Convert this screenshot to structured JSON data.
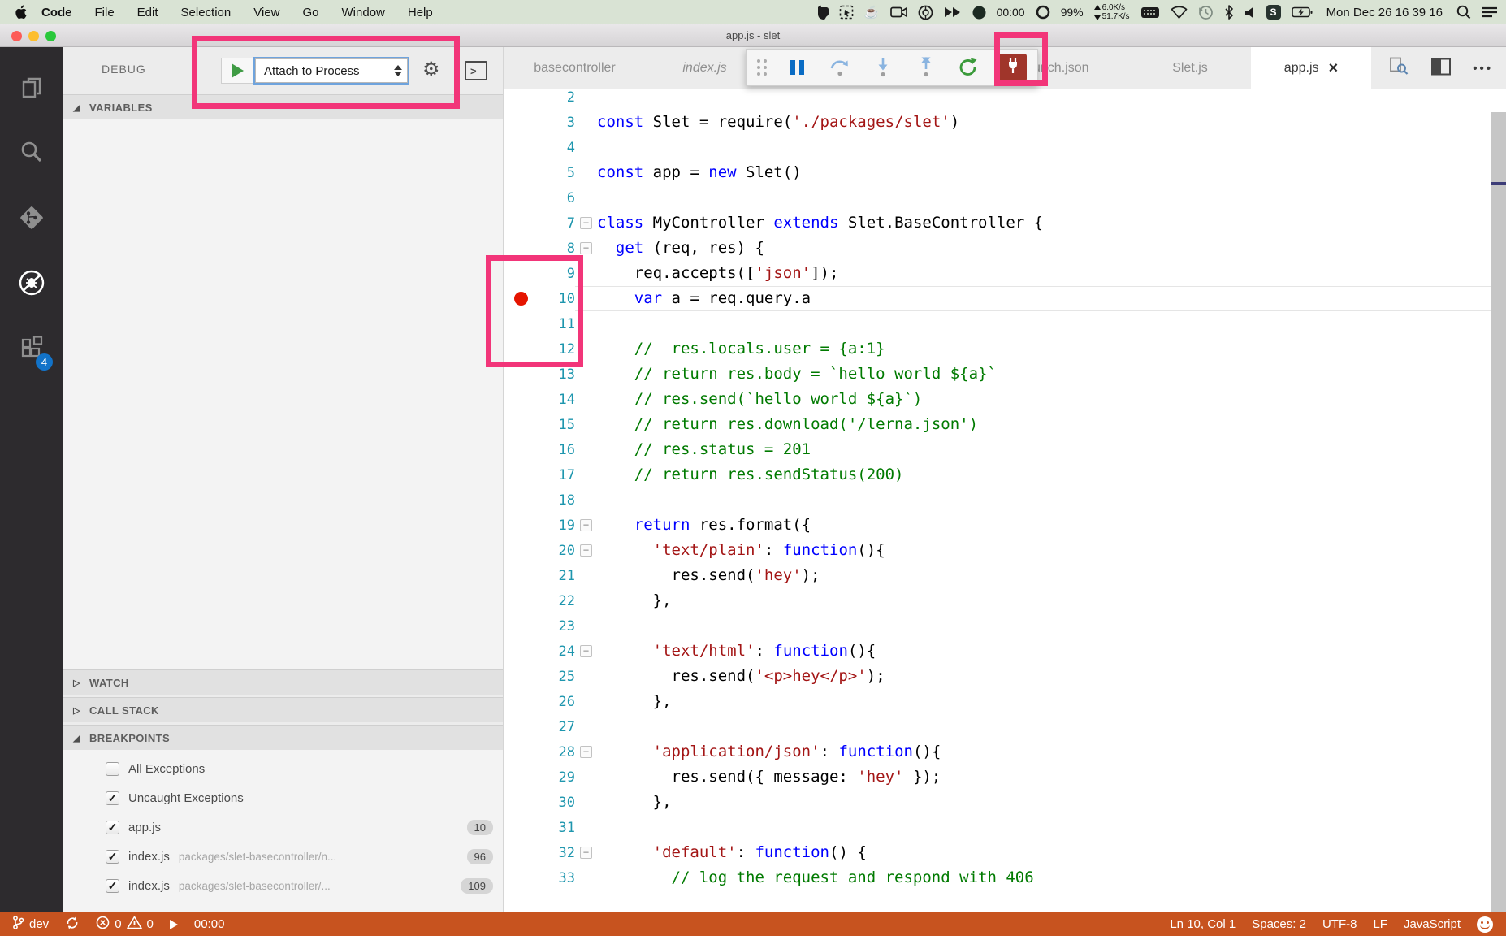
{
  "menubar": {
    "items": [
      "Code",
      "File",
      "Edit",
      "Selection",
      "View",
      "Go",
      "Window",
      "Help"
    ],
    "status": {
      "rec_time": "00:00",
      "battery_pct": "99%",
      "net_up": "6.0K/s",
      "net_down": "51.7K/s",
      "s_badge": "S",
      "clock": "Mon Dec 26  16 39 16"
    }
  },
  "titlebar": {
    "title": "app.js - slet"
  },
  "activitybar": {
    "extensions_badge": "4"
  },
  "sidebar": {
    "debug_label": "DEBUG",
    "launch_config": "Attach to Process",
    "sections": {
      "variables": "VARIABLES",
      "watch": "WATCH",
      "call_stack": "CALL STACK",
      "breakpoints": "BREAKPOINTS"
    },
    "breakpoints": [
      {
        "label": "All Exceptions",
        "checked": false
      },
      {
        "label": "Uncaught Exceptions",
        "checked": true
      },
      {
        "label": "app.js",
        "checked": true,
        "badge": "10"
      },
      {
        "label": "index.js",
        "path": "packages/slet-basecontroller/n...",
        "checked": true,
        "badge": "96"
      },
      {
        "label": "index.js",
        "path": "packages/slet-basecontroller/...",
        "checked": true,
        "badge": "109"
      }
    ]
  },
  "editor": {
    "tabs": [
      {
        "label": "basecontroller",
        "state": "inactive"
      },
      {
        "label": "index.js",
        "state": "inactive-preview"
      },
      {
        "label": "unch.json",
        "state": "inactive-partially-hidden"
      },
      {
        "label": "Slet.js",
        "state": "inactive"
      },
      {
        "label": "app.js",
        "state": "active"
      }
    ],
    "lines": [
      {
        "n": 2,
        "tk": []
      },
      {
        "n": 3,
        "tk": [
          [
            "k",
            "const"
          ],
          [
            "t",
            " Slet = require("
          ],
          [
            "s",
            "'./packages/slet'"
          ],
          [
            "t",
            ")"
          ]
        ]
      },
      {
        "n": 4,
        "tk": []
      },
      {
        "n": 5,
        "tk": [
          [
            "k",
            "const"
          ],
          [
            "t",
            " app = "
          ],
          [
            "k",
            "new"
          ],
          [
            "t",
            " Slet()"
          ]
        ]
      },
      {
        "n": 6,
        "tk": []
      },
      {
        "n": 7,
        "f": 1,
        "tk": [
          [
            "k",
            "class"
          ],
          [
            "t",
            " MyController "
          ],
          [
            "k",
            "extends"
          ],
          [
            "t",
            " Slet.BaseController {"
          ]
        ]
      },
      {
        "n": 8,
        "f": 1,
        "tk": [
          [
            "t",
            "  "
          ],
          [
            "k",
            "get"
          ],
          [
            "t",
            " (req, res) {"
          ]
        ]
      },
      {
        "n": 9,
        "tk": [
          [
            "t",
            "    req.accepts(["
          ],
          [
            "s",
            "'json'"
          ],
          [
            "t",
            "]);"
          ]
        ]
      },
      {
        "n": 10,
        "b": 1,
        "cur": 1,
        "tk": [
          [
            "t",
            "    "
          ],
          [
            "k",
            "var"
          ],
          [
            "t",
            " a = req.query.a"
          ]
        ]
      },
      {
        "n": 11,
        "tk": []
      },
      {
        "n": 12,
        "tk": [
          [
            "t",
            "    "
          ],
          [
            "c",
            "//  res.locals.user = {a:1}"
          ]
        ]
      },
      {
        "n": 13,
        "tk": [
          [
            "t",
            "    "
          ],
          [
            "c",
            "// return res.body = `hello world ${a}`"
          ]
        ]
      },
      {
        "n": 14,
        "tk": [
          [
            "t",
            "    "
          ],
          [
            "c",
            "// res.send(`hello world ${a}`)"
          ]
        ]
      },
      {
        "n": 15,
        "tk": [
          [
            "t",
            "    "
          ],
          [
            "c",
            "// return res.download('/lerna.json')"
          ]
        ]
      },
      {
        "n": 16,
        "tk": [
          [
            "t",
            "    "
          ],
          [
            "c",
            "// res.status = 201"
          ]
        ]
      },
      {
        "n": 17,
        "tk": [
          [
            "t",
            "    "
          ],
          [
            "c",
            "// return res.sendStatus(200)"
          ]
        ]
      },
      {
        "n": 18,
        "tk": []
      },
      {
        "n": 19,
        "f": 1,
        "tk": [
          [
            "t",
            "    "
          ],
          [
            "k",
            "return"
          ],
          [
            "t",
            " res.format({"
          ]
        ]
      },
      {
        "n": 20,
        "f": 1,
        "tk": [
          [
            "t",
            "      "
          ],
          [
            "s",
            "'text/plain'"
          ],
          [
            "t",
            ": "
          ],
          [
            "k",
            "function"
          ],
          [
            "t",
            "(){"
          ]
        ]
      },
      {
        "n": 21,
        "tk": [
          [
            "t",
            "        res.send("
          ],
          [
            "s",
            "'hey'"
          ],
          [
            "t",
            ");"
          ]
        ]
      },
      {
        "n": 22,
        "tk": [
          [
            "t",
            "      },"
          ]
        ]
      },
      {
        "n": 23,
        "tk": []
      },
      {
        "n": 24,
        "f": 1,
        "tk": [
          [
            "t",
            "      "
          ],
          [
            "s",
            "'text/html'"
          ],
          [
            "t",
            ": "
          ],
          [
            "k",
            "function"
          ],
          [
            "t",
            "(){"
          ]
        ]
      },
      {
        "n": 25,
        "tk": [
          [
            "t",
            "        res.send("
          ],
          [
            "s",
            "'<p>hey</p>'"
          ],
          [
            "t",
            ");"
          ]
        ]
      },
      {
        "n": 26,
        "tk": [
          [
            "t",
            "      },"
          ]
        ]
      },
      {
        "n": 27,
        "tk": []
      },
      {
        "n": 28,
        "f": 1,
        "tk": [
          [
            "t",
            "      "
          ],
          [
            "s",
            "'application/json'"
          ],
          [
            "t",
            ": "
          ],
          [
            "k",
            "function"
          ],
          [
            "t",
            "(){"
          ]
        ]
      },
      {
        "n": 29,
        "tk": [
          [
            "t",
            "        res.send({ message: "
          ],
          [
            "s",
            "'hey'"
          ],
          [
            "t",
            " });"
          ]
        ]
      },
      {
        "n": 30,
        "tk": [
          [
            "t",
            "      },"
          ]
        ]
      },
      {
        "n": 31,
        "tk": []
      },
      {
        "n": 32,
        "f": 1,
        "tk": [
          [
            "t",
            "      "
          ],
          [
            "s",
            "'default'"
          ],
          [
            "t",
            ": "
          ],
          [
            "k",
            "function"
          ],
          [
            "t",
            "() {"
          ]
        ]
      },
      {
        "n": 33,
        "tk": [
          [
            "t",
            "        "
          ],
          [
            "c",
            "// log the request and respond with 406"
          ]
        ]
      }
    ]
  },
  "statusbar": {
    "branch": "dev",
    "errors": "0",
    "warnings": "0",
    "timer": "00:00",
    "position": "Ln 10, Col 1",
    "indent": "Spaces: 2",
    "encoding": "UTF-8",
    "eol": "LF",
    "language": "JavaScript"
  },
  "icons": {
    "gear": "⚙",
    "console": ">",
    "twisty_open": "◢",
    "twisty_closed": "▷",
    "check": "✓",
    "fold": "−",
    "close": "×",
    "ellipsis": "•••"
  },
  "colors": {
    "annotation_pink": "#f23579",
    "statusbar_orange": "#c7531f",
    "breakpoint_red": "#e51400",
    "badge_blue": "#1273c9",
    "keyword_blue": "#0000ff",
    "string_red": "#a31515",
    "comment_green": "#007a00"
  }
}
